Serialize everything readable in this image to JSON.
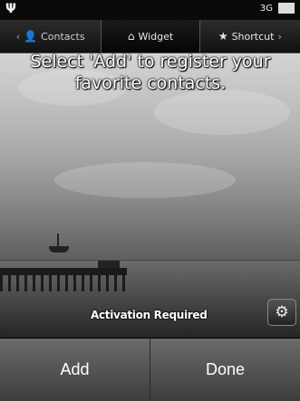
{
  "status_bar": {
    "signal_icon": "antenna-icon",
    "indicator_text": "3G",
    "battery_icon": "battery-icon"
  },
  "tabs": [
    {
      "label": "Contacts",
      "icon": "person-icon",
      "selected": false
    },
    {
      "label": "Widget",
      "icon": "home-icon",
      "selected": true
    },
    {
      "label": "Shortcut",
      "icon": "star-icon",
      "selected": false
    }
  ],
  "wallpaper": {
    "message": "Select 'Add' to register your favorite contacts."
  },
  "activation": {
    "label": "Activation Required",
    "settings_icon": "gear-icon"
  },
  "bottom_bar": {
    "add_label": "Add",
    "done_label": "Done"
  }
}
